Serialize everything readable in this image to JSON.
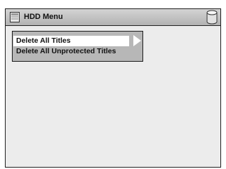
{
  "window": {
    "title": "HDD Menu",
    "title_icon": "hdd-icon",
    "corner_icon": "hdd-cylinder-icon"
  },
  "menu": {
    "items": [
      {
        "label": "Delete All Titles",
        "selected": true
      },
      {
        "label": "Delete All Unprotected Titles",
        "selected": false
      }
    ],
    "submenu_indicator_icon": "triangle-right-icon"
  },
  "colors": {
    "background": "#ececec",
    "title_bar": "#c4c4c4",
    "submenu_panel": "#b7b7b7",
    "selected_item": "#ffffff",
    "text": "#111111"
  }
}
